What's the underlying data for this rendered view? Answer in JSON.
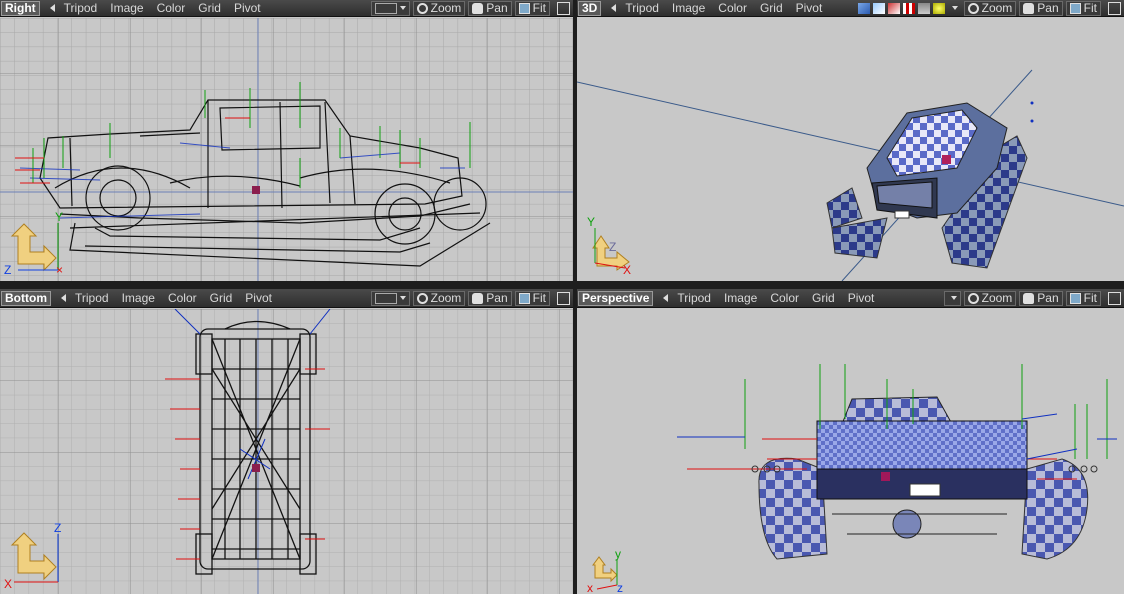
{
  "menu": [
    "Tripod",
    "Image",
    "Color",
    "Grid",
    "Pivot"
  ],
  "tools": {
    "zoom": "Zoom",
    "pan": "Pan",
    "fit": "Fit"
  },
  "viewports": {
    "top_left": {
      "name": "Right",
      "axes": {
        "vertical": "Y",
        "horizontal": "Z"
      }
    },
    "top_right": {
      "name": "3D",
      "axes": {
        "vertical": "Y",
        "horizontal": "X",
        "depth": "Z"
      }
    },
    "bottom_left": {
      "name": "Bottom",
      "axes": {
        "vertical": "Z",
        "horizontal": "X"
      }
    },
    "bottom_right": {
      "name": "Perspective",
      "axes": {
        "vertical": "y",
        "horizontal": "x",
        "depth": "z"
      }
    }
  },
  "colors": {
    "viewport_bg": "#c8c8c8",
    "toolbar_bg": "#3a3a3a",
    "wire": "#111111",
    "axis_x": "#e01010",
    "axis_y": "#10a010",
    "axis_z": "#1040e0",
    "gizmo": "#f0d080"
  }
}
